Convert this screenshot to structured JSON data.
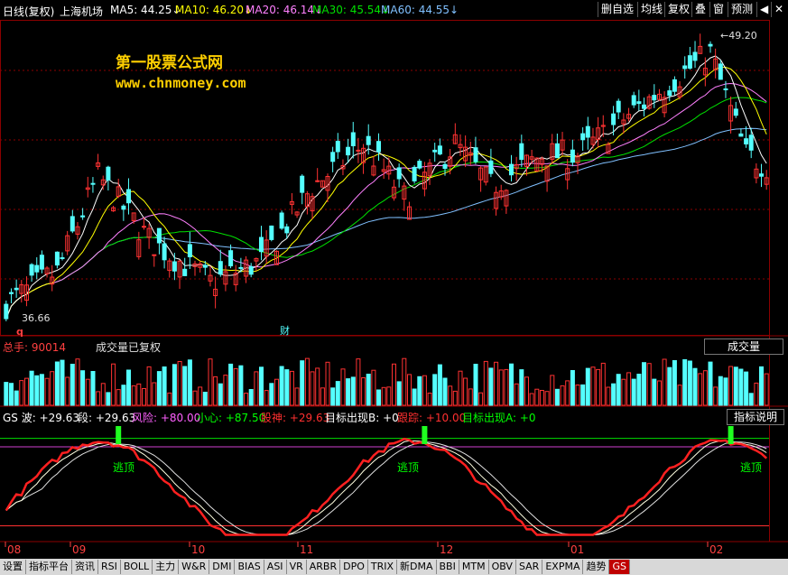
{
  "header": {
    "title": "日线(复权)",
    "stock_name": "上海机场",
    "ma5": "MA5: 44.25↓",
    "ma10": "MA10: 46.20↓",
    "ma20": "MA20: 46.14↓",
    "ma30": "MA30: 45.54↓",
    "ma60": "MA60: 44.55↓",
    "buttons": [
      "删自选",
      "均线",
      "复权",
      "叠",
      "窗",
      "预测",
      "◀",
      "✕"
    ]
  },
  "watermark": {
    "line1": "第一股票公式网",
    "line2": "www.chnmoney.com"
  },
  "price_annotations": {
    "high": "←49.20",
    "low": "36.66",
    "q_marker": "q",
    "cai_marker": "财"
  },
  "volume_panel": {
    "total_label": "总手: 90014",
    "note": "成交量已复权",
    "selector": "成交量"
  },
  "gs_panel": {
    "gs": "GS 波: +29.63",
    "duan": "段: +29.63",
    "fengxian": "风险: +80.00",
    "xiaoxin": "小心: +87.50",
    "gushen": "股神: +29.63",
    "target_b": "目标出现B: +0",
    "genzong": "跟踪: +10.00",
    "target_a": "目标出现A: +0",
    "button": "指标说明",
    "signal_text": "逃顶"
  },
  "x_axis": {
    "labels": [
      "08",
      "09",
      "10",
      "11",
      "12",
      "01",
      "02"
    ]
  },
  "tabs": [
    "设置",
    "指标平台",
    "资讯",
    "RSI",
    "BOLL",
    "主力",
    "W&R",
    "DMI",
    "BIAS",
    "ASI",
    "VR",
    "ARBR",
    "DPO",
    "TRIX",
    "新DMA",
    "BBI",
    "MTM",
    "OBV",
    "SAR",
    "EXPMA",
    "趋势",
    "GS"
  ],
  "colors": {
    "up": "#ff3232",
    "down": "#54ffff",
    "ma5": "#ffffff",
    "ma10": "#ffff00",
    "ma20": "#ff80ff",
    "ma30": "#00e000",
    "ma60": "#80c0ff",
    "grid": "#8b0000"
  },
  "chart_data": {
    "type": "candlestick",
    "series_count": 150,
    "price_range": [
      36.0,
      50.0
    ],
    "high": 49.2,
    "low": 36.66,
    "price_path_keypoints": [
      [
        0,
        37.0
      ],
      [
        10,
        38.5
      ],
      [
        18,
        43.0
      ],
      [
        28,
        40.0
      ],
      [
        40,
        38.0
      ],
      [
        50,
        39.0
      ],
      [
        60,
        42.5
      ],
      [
        70,
        44.5
      ],
      [
        78,
        42.0
      ],
      [
        88,
        44.5
      ],
      [
        95,
        42.5
      ],
      [
        105,
        44.0
      ],
      [
        112,
        44.0
      ],
      [
        120,
        45.5
      ],
      [
        128,
        47.0
      ],
      [
        138,
        48.8
      ],
      [
        145,
        44.0
      ],
      [
        149,
        43.5
      ]
    ],
    "volume_range": [
      0,
      1
    ],
    "gs_range": [
      0,
      100
    ],
    "gs_risk_line": 80.0,
    "gs_caution_line": 87.5,
    "gs_track_line": 10.0,
    "gs_current": 29.63,
    "signal_points": [
      22,
      82,
      142
    ]
  }
}
